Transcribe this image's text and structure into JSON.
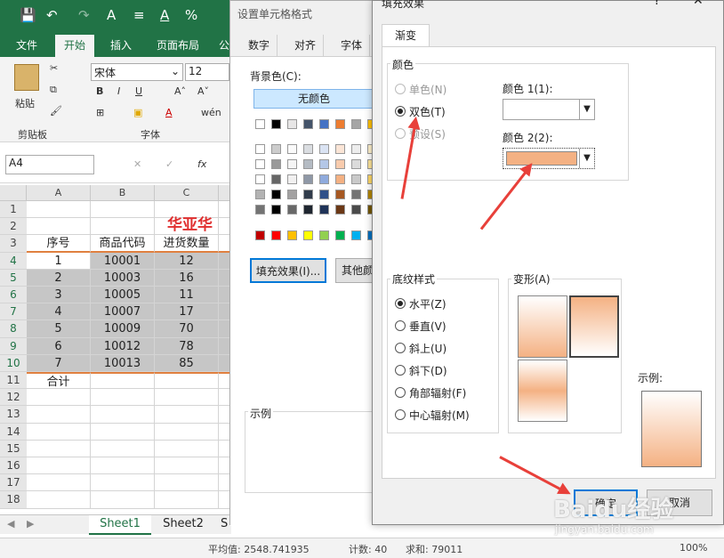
{
  "excel": {
    "ribbon_tabs": [
      "文件",
      "开始",
      "插入",
      "页面布局",
      "公"
    ],
    "clipboard": {
      "paste_label": "粘贴",
      "group_label": "剪贴板"
    },
    "font": {
      "name": "宋体",
      "size": "12",
      "group_label": "字体",
      "bold": "B",
      "italic": "I",
      "underline": "U"
    },
    "name_box": "A4",
    "formula_icon": "fx",
    "columns": [
      "A",
      "B",
      "C"
    ],
    "title_text": "华亚华",
    "rows": [
      {
        "n": "1"
      },
      {
        "n": "2"
      },
      {
        "n": "3",
        "a": "序号",
        "b": "商品代码",
        "c": "进货数量"
      },
      {
        "n": "4",
        "a": "1",
        "b": "10001",
        "c": "12"
      },
      {
        "n": "5",
        "a": "2",
        "b": "10003",
        "c": "16"
      },
      {
        "n": "6",
        "a": "3",
        "b": "10005",
        "c": "11"
      },
      {
        "n": "7",
        "a": "4",
        "b": "10007",
        "c": "17"
      },
      {
        "n": "8",
        "a": "5",
        "b": "10009",
        "c": "70"
      },
      {
        "n": "9",
        "a": "6",
        "b": "10012",
        "c": "78"
      },
      {
        "n": "10",
        "a": "7",
        "b": "10013",
        "c": "85"
      },
      {
        "n": "11",
        "a": "合计"
      },
      {
        "n": "12"
      },
      {
        "n": "13"
      },
      {
        "n": "14"
      },
      {
        "n": "15"
      },
      {
        "n": "16"
      },
      {
        "n": "17"
      },
      {
        "n": "18"
      }
    ],
    "sheets": [
      "Sheet1",
      "Sheet2",
      "S"
    ],
    "status": {
      "avg": "平均值: 2548.741935",
      "count": "计数: 40",
      "sum": "求和: 79011",
      "zoom": "100%"
    }
  },
  "format_dialog": {
    "title": "设置单元格格式",
    "tabs": [
      "数字",
      "对齐",
      "字体"
    ],
    "bg_color_label": "背景色(C):",
    "no_color_button": "无颜色",
    "fill_effects_button": "填充效果(I)...",
    "more_colors_button": "其他颜",
    "sample_label": "示例",
    "palette_row_top": [
      "#ffffff",
      "#000000",
      "#e7e6e6",
      "#44546a",
      "#4472c4",
      "#ed7d31",
      "#a5a5a5",
      "#ffc000",
      "#5b9bd5"
    ],
    "palette_standard": [
      "#c00000",
      "#ff0000",
      "#ffc000",
      "#ffff00",
      "#92d050",
      "#00b050",
      "#00b0f0",
      "#0070c0"
    ]
  },
  "fill_dialog": {
    "title": "填充效果",
    "tab": "渐变",
    "colors_group": "颜色",
    "one_color": "单色(N)",
    "two_colors": "双色(T)",
    "preset": "预设(S)",
    "color1_label": "颜色 1(1):",
    "color2_label": "颜色 2(2):",
    "color2_value": "#f4b183",
    "shading_group": "底纹样式",
    "shading_options": [
      "水平(Z)",
      "垂直(V)",
      "斜上(U)",
      "斜下(D)",
      "角部辐射(F)",
      "中心辐射(M)"
    ],
    "selected_shading": "水平(Z)",
    "variants_label": "变形(A)",
    "sample_label": "示例:",
    "ok_button": "确定",
    "cancel_button": "取消"
  },
  "watermark": {
    "brand": "Baidu经验",
    "url": "jingyan.baidu.com"
  }
}
